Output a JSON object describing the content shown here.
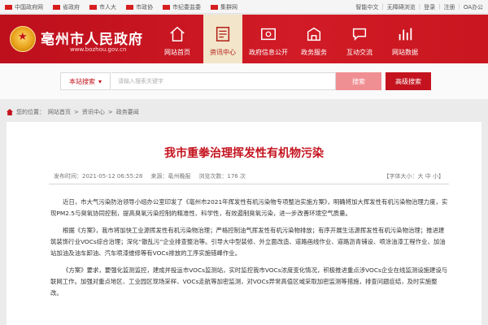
{
  "topbar": {
    "links": [
      {
        "label": "中国政府网"
      },
      {
        "label": "省政府"
      },
      {
        "label": "市人大"
      },
      {
        "label": "市政协"
      },
      {
        "label": "市纪委监委"
      },
      {
        "label": "集群网"
      }
    ],
    "right": [
      "智能中文",
      "无障碍浏览",
      "登录",
      "注册",
      "OA办公"
    ]
  },
  "header": {
    "title": "亳州市人民政府",
    "url": "www.bozhou.gov.cn",
    "nav": [
      {
        "label": "网站首页",
        "icon": "home-icon"
      },
      {
        "label": "资讯中心",
        "icon": "news-icon",
        "active": true
      },
      {
        "label": "政府信息公开",
        "icon": "info-open-icon"
      },
      {
        "label": "政务服务",
        "icon": "service-icon"
      },
      {
        "label": "互动交流",
        "icon": "chat-icon"
      },
      {
        "label": "网站数据",
        "icon": "data-icon"
      }
    ]
  },
  "search": {
    "scope": "本站搜索",
    "placeholder": "请输入搜索关键字",
    "button": "搜索",
    "advanced": "高级搜索"
  },
  "breadcrumb": [
    "您的位置：",
    "网站首页",
    "资讯中心",
    "政务要闻"
  ],
  "article": {
    "title": "我市重拳治理挥发性有机物污染",
    "date": "发布时间：2021-05-12 06:55:28",
    "source": "来源：亳州晚报",
    "views": "浏览次数：176 次",
    "fontsize": "【字体大小：大 中 小】",
    "paragraphs": [
      "近日，市大气污染防治领导小组办公室印发了《亳州市2021年挥发性有机污染物专项整治实施方案》，明确将加大挥发性有机污染物治理力度，实现PM2.5与臭氧协同控制，提高臭氧污染控制的精准性、科学性，有效遏制臭氧污染，进一步改善环境空气质量。",
      "根据《方案》，我市将加快工业源挥发性有机污染物治理；严格控制油气挥发性有机污染物排放；有序开展生活源挥发性有机污染物治理；推进建筑装饰行业VOCs综合治理；深化“散乱污”企业排查整治等。引导大中型装修、外立面改造、道路画线作业、道路沥青铺设、喷涂油漆工程作业、加油站加油及油车卸油、汽车喷漆维修等有VOCs排放的工序实施错峰作业。",
      "《方案》要求，要强化监测监控，建成并投运市VOCs监测站，实时监控我市VOCs浓度变化情况，积极推进重点涉VOCs企业在线监测设施建设与联网工作。加强对重点地区、工业园区现场采样、VOCs走航等加密监测，对VOCs异常高值区域采取加密监测等措施，排查问题症结，及时实施整改。"
    ]
  },
  "colors": {
    "brand": "#c4131e",
    "nav_active_bg": "#f2e5c9"
  }
}
